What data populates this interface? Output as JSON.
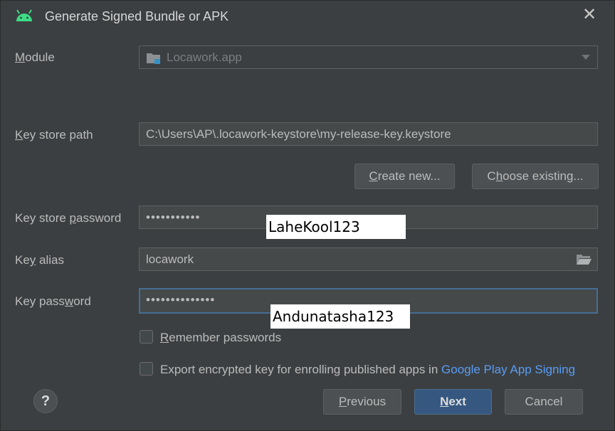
{
  "dialog": {
    "title": "Generate Signed Bundle or APK",
    "close_glyph": "✕"
  },
  "module": {
    "label_prefix": "",
    "label_mnemonic": "M",
    "label_rest": "odule",
    "value": "Locawork.app"
  },
  "keystore_path": {
    "label_mnemonic": "K",
    "label_rest": "ey store path",
    "value": "C:\\Users\\AP\\.locawork-keystore\\my-release-key.keystore"
  },
  "buttons": {
    "create_new_mnemonic": "C",
    "create_new_rest": "reate new...",
    "choose_existing_prefix": "C",
    "choose_existing_mnemonic": "h",
    "choose_existing_rest": "oose existing...",
    "previous_mnemonic": "P",
    "previous_rest": "revious",
    "next_mnemonic": "N",
    "next_rest": "ext",
    "cancel": "Cancel",
    "help": "?"
  },
  "keystore_password": {
    "label_prefix": "Key store ",
    "label_mnemonic": "p",
    "label_rest": "assword",
    "masked_value": "•••••••••••"
  },
  "key_alias": {
    "label_prefix": "Ke",
    "label_mnemonic": "y",
    "label_rest": " alias",
    "value": "locawork"
  },
  "key_password": {
    "label_prefix": "Key pass",
    "label_mnemonic": "w",
    "label_rest": "ord",
    "masked_value": "••••••••••••••"
  },
  "options": {
    "remember_mnemonic": "R",
    "remember_rest": "emember passwords",
    "export_text": "Export encrypted key for enrolling published apps in ",
    "export_link": "Google Play App Signing"
  },
  "overlays": {
    "keystore_password_note": "LaheKool123",
    "key_password_note": "Andunatasha123"
  },
  "icons": {
    "app": "android-icon",
    "module": "module-folder-icon",
    "browse": "folder-open-icon",
    "close": "close-icon",
    "dropdown": "chevron-down-icon"
  },
  "colors": {
    "background": "#3c3f41",
    "field": "#45494a",
    "primary_button": "#365880",
    "link": "#589df6",
    "android_green": "#3ddc84"
  }
}
